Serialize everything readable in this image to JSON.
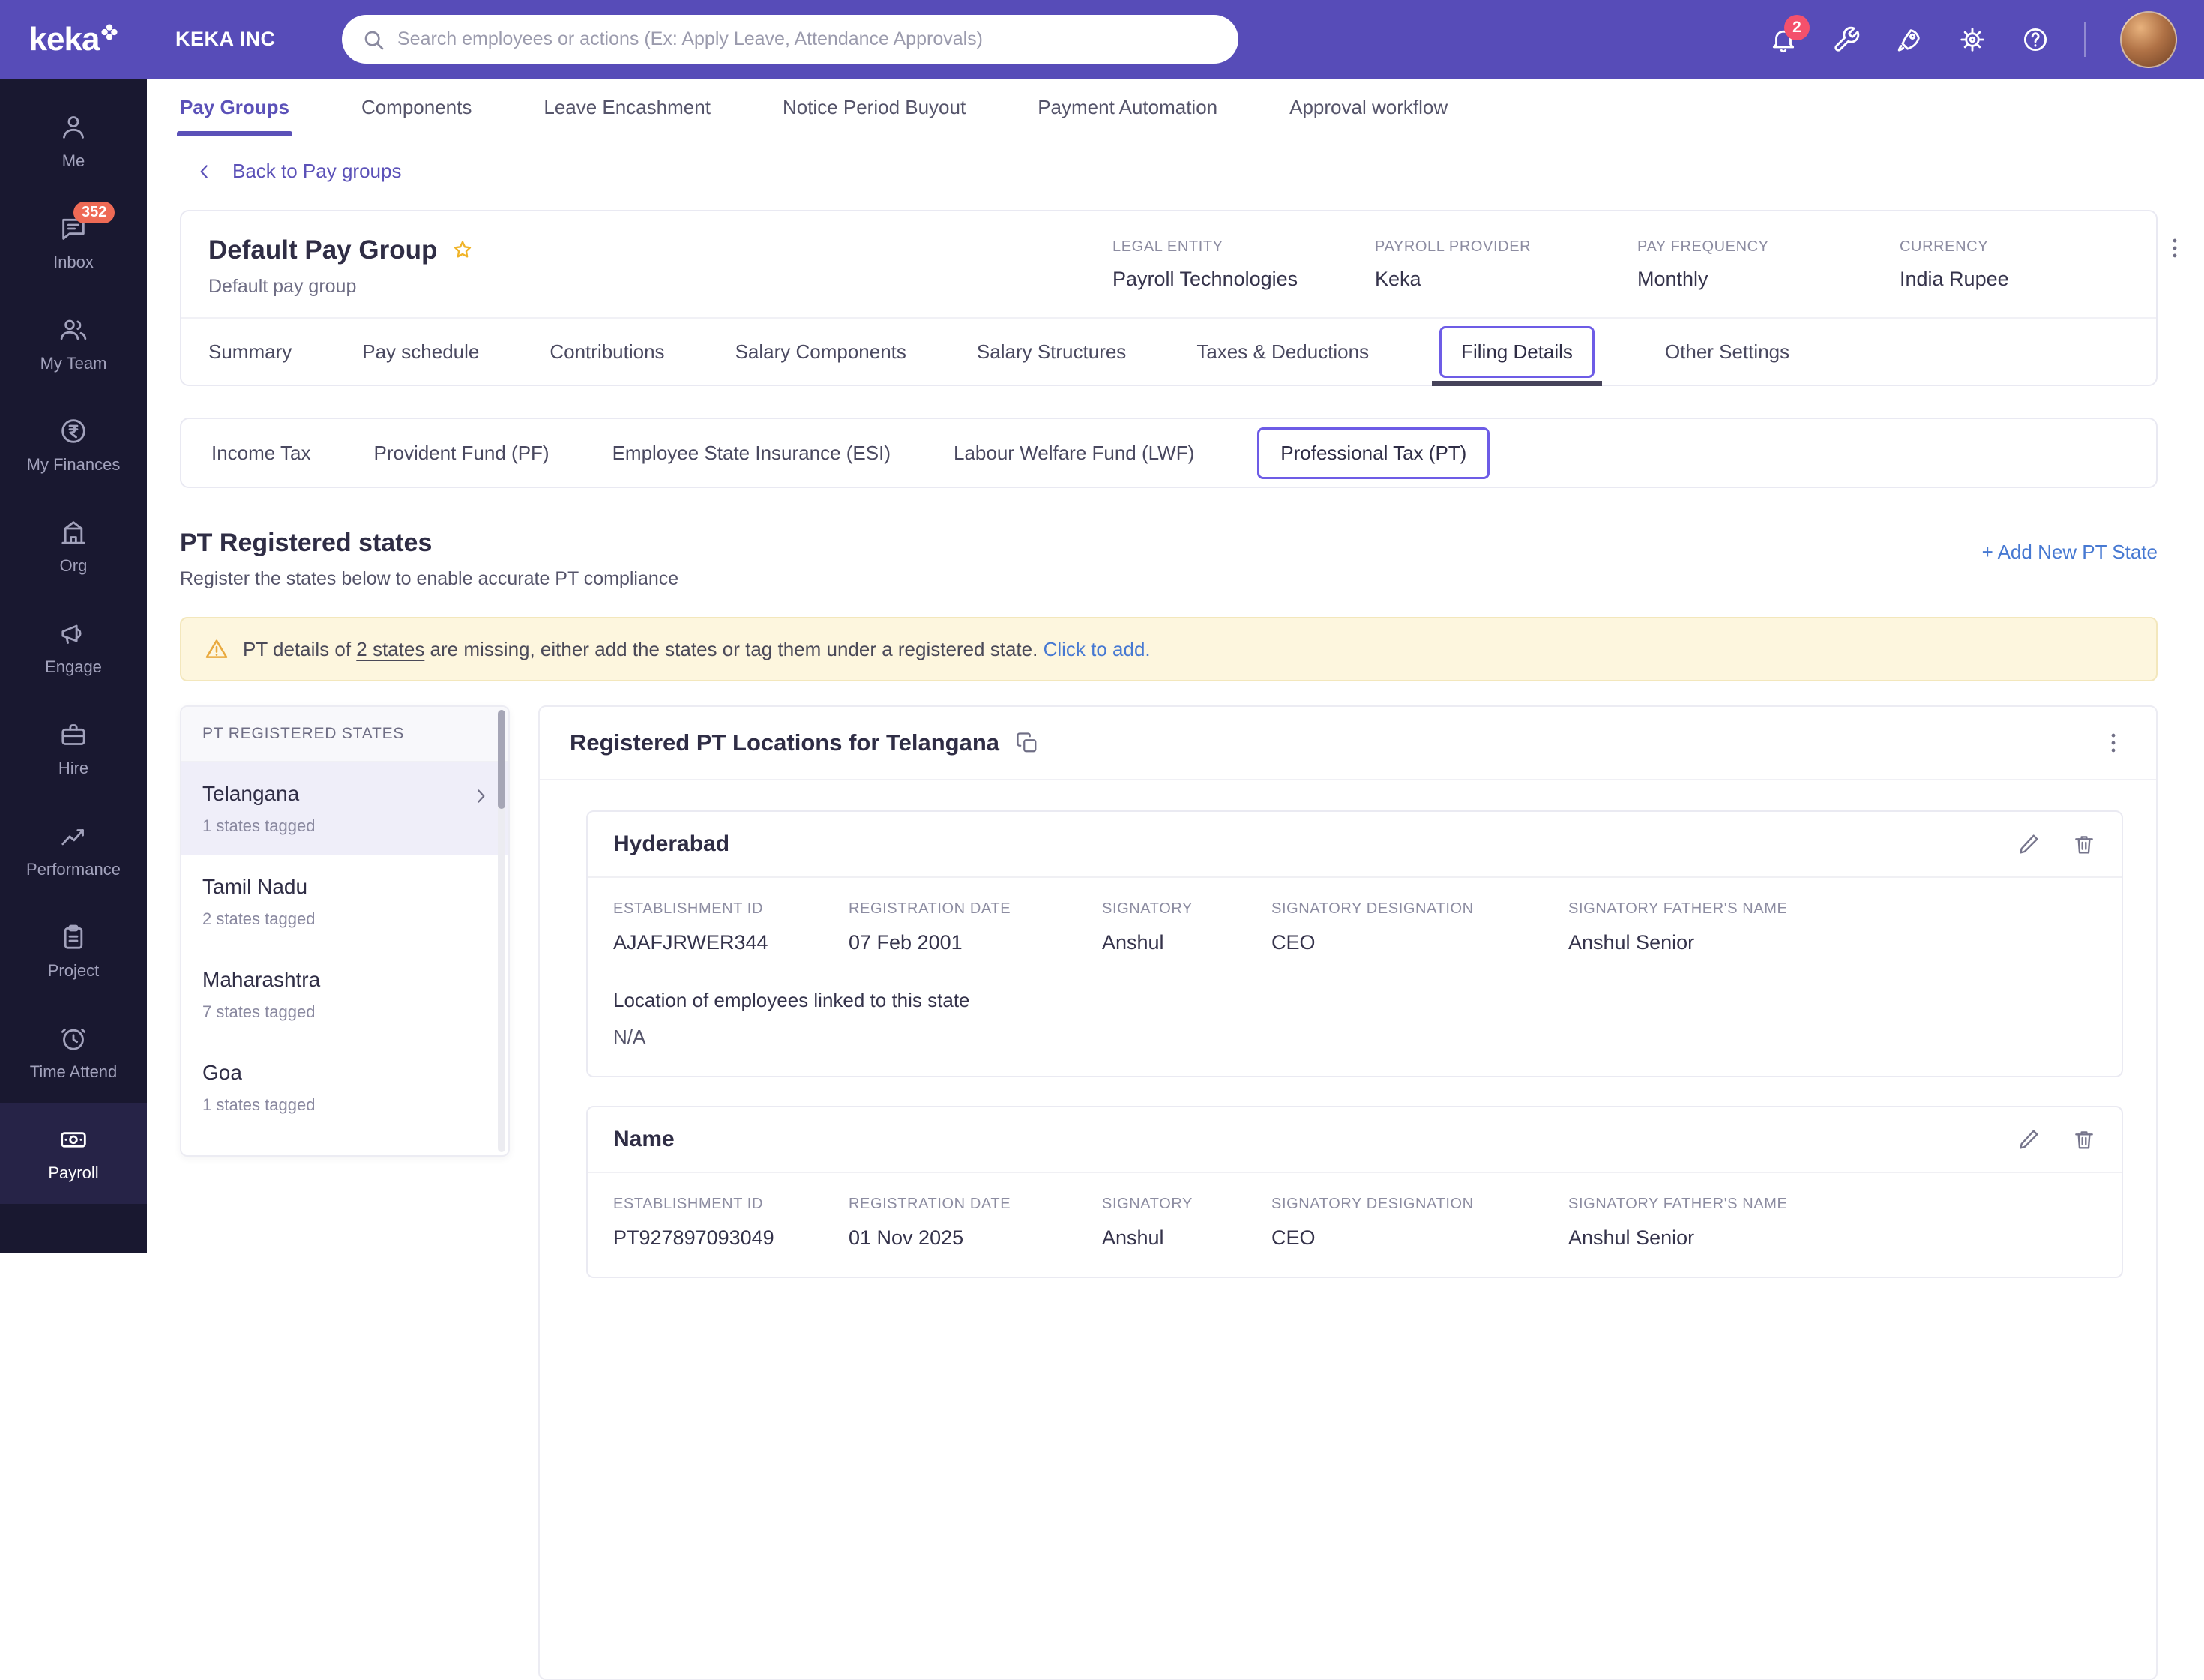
{
  "brand": {
    "logo_text": "keka"
  },
  "header": {
    "company_name": "KEKA INC",
    "search_placeholder": "Search employees or actions (Ex: Apply Leave, Attendance Approvals)",
    "notification_count": "2"
  },
  "sidebar": {
    "items": [
      {
        "label": "Me"
      },
      {
        "label": "Inbox",
        "badge": "352"
      },
      {
        "label": "My Team"
      },
      {
        "label": "My Finances"
      },
      {
        "label": "Org"
      },
      {
        "label": "Engage"
      },
      {
        "label": "Hire"
      },
      {
        "label": "Performance"
      },
      {
        "label": "Project"
      },
      {
        "label": "Time Attend"
      },
      {
        "label": "Payroll"
      }
    ]
  },
  "top_tabs": [
    "Pay Groups",
    "Components",
    "Leave Encashment",
    "Notice Period Buyout",
    "Payment Automation",
    "Approval workflow"
  ],
  "back_link": "Back to Pay groups",
  "pay_group": {
    "title": "Default Pay Group",
    "subtitle": "Default pay group",
    "meta": [
      {
        "label": "LEGAL ENTITY",
        "value": "Payroll Technologies"
      },
      {
        "label": "PAYROLL PROVIDER",
        "value": "Keka"
      },
      {
        "label": "PAY FREQUENCY",
        "value": "Monthly"
      },
      {
        "label": "CURRENCY",
        "value": "India Rupee"
      }
    ],
    "tabs": [
      "Summary",
      "Pay schedule",
      "Contributions",
      "Salary Components",
      "Salary Structures",
      "Taxes & Deductions",
      "Filing Details",
      "Other Settings"
    ]
  },
  "filing_tabs": [
    "Income Tax",
    "Provident Fund (PF)",
    "Employee State Insurance (ESI)",
    "Labour Welfare Fund (LWF)",
    "Professional Tax (PT)"
  ],
  "pt_section": {
    "title": "PT Registered states",
    "subtitle": "Register the states below to enable accurate PT compliance",
    "add_link": "+ Add New PT State",
    "warning": {
      "prefix": "PT details of ",
      "highlight": "2 states",
      "middle": " are missing, either add the states or tag them under a registered state. ",
      "link": "Click to add."
    }
  },
  "states_panel": {
    "header": "PT REGISTERED STATES",
    "items": [
      {
        "name": "Telangana",
        "tagged": "1 states tagged"
      },
      {
        "name": "Tamil Nadu",
        "tagged": "2 states tagged"
      },
      {
        "name": "Maharashtra",
        "tagged": "7 states tagged"
      },
      {
        "name": "Goa",
        "tagged": "1 states tagged"
      }
    ]
  },
  "locations_panel": {
    "title": "Registered PT Locations for Telangana",
    "cards": [
      {
        "name": "Hyderabad",
        "fields": [
          {
            "label": "ESTABLISHMENT ID",
            "value": "AJAFJRWER344"
          },
          {
            "label": "REGISTRATION DATE",
            "value": "07 Feb 2001"
          },
          {
            "label": "SIGNATORY",
            "value": "Anshul"
          },
          {
            "label": "SIGNATORY DESIGNATION",
            "value": "CEO"
          },
          {
            "label": "SIGNATORY FATHER'S NAME",
            "value": "Anshul Senior"
          }
        ],
        "linked_label": "Location of employees linked to this state",
        "linked_value": "N/A"
      },
      {
        "name": "Name",
        "fields": [
          {
            "label": "ESTABLISHMENT ID",
            "value": "PT927897093049"
          },
          {
            "label": "REGISTRATION DATE",
            "value": "01 Nov 2025"
          },
          {
            "label": "SIGNATORY",
            "value": "Anshul"
          },
          {
            "label": "SIGNATORY DESIGNATION",
            "value": "CEO"
          },
          {
            "label": "SIGNATORY FATHER'S NAME",
            "value": "Anshul Senior"
          }
        ]
      }
    ]
  }
}
